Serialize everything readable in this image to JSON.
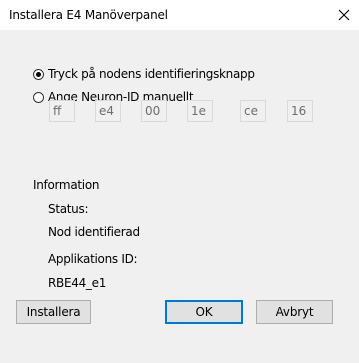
{
  "window": {
    "title": "Installera E4 Manöverpanel"
  },
  "options": {
    "identify_button": "Tryck på nodens identifieringsknapp",
    "manual_neuron_id": "Ange Neuron-ID manuellt",
    "selected": "identify_button"
  },
  "neuron_id": [
    "ff",
    "e4",
    "00",
    "1e",
    "ce",
    "16"
  ],
  "information": {
    "heading": "Information",
    "status_label": "Status:",
    "status_value": "Nod identifierad",
    "app_id_label": "Applikations ID:",
    "app_id_value": "RBE44_e1"
  },
  "buttons": {
    "install": "Installera",
    "ok": "OK",
    "cancel": "Avbryt"
  },
  "icons": {
    "close": "close-icon"
  }
}
